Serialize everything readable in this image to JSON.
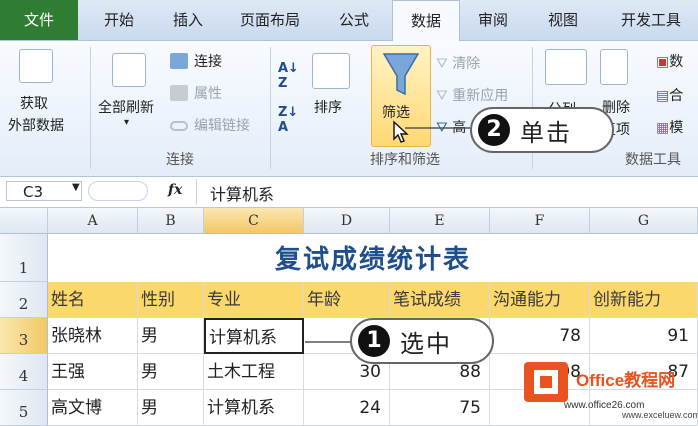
{
  "tabs": [
    "文件",
    "开始",
    "插入",
    "页面布局",
    "公式",
    "数据",
    "审阅",
    "视图",
    "开发工具"
  ],
  "ribbon": {
    "get_external_1": "获取",
    "get_external_2": "外部数据",
    "refresh_all": "全部刷新",
    "connections": "连接",
    "properties": "属性",
    "edit_links": "编辑链接",
    "group_connections": "连接",
    "sort": "排序",
    "filter": "筛选",
    "clear": "清除",
    "reapply": "重新应用",
    "advanced": "高",
    "group_sort_filter": "排序和筛选",
    "split": "分列",
    "remove": "删除",
    "remove_2": "复项",
    "data_label": "数",
    "consolidate": "合",
    "model": "模",
    "group_data_tools": "数据工具"
  },
  "formula_bar": {
    "name_box": "C3",
    "fx": "fx",
    "content": "计算机系"
  },
  "columns": [
    "A",
    "B",
    "C",
    "D",
    "E",
    "F",
    "G"
  ],
  "rows": [
    "1",
    "2",
    "3",
    "4",
    "5"
  ],
  "sheet": {
    "title": "复试成绩统计表",
    "headers": [
      "姓名",
      "性别",
      "专业",
      "年龄",
      "笔试成绩",
      "沟通能力",
      "创新能力"
    ],
    "data": [
      [
        "张晓林",
        "男",
        "计算机系",
        "",
        "",
        "78",
        "91"
      ],
      [
        "王强",
        "男",
        "土木工程",
        "30",
        "88",
        "98",
        "87"
      ],
      [
        "高文博",
        "男",
        "计算机系",
        "24",
        "75",
        "",
        ""
      ]
    ]
  },
  "callouts": [
    {
      "num": "2",
      "text": "单击"
    },
    {
      "num": "1",
      "text": "选中"
    }
  ],
  "watermark": {
    "brand": "Office教程网",
    "url": "www.office26.com",
    "url2": "www.exceluew.com"
  },
  "colors": {
    "file_tab": "#2e7d32",
    "header_fill": "#fbd86a",
    "title_text": "#1f4e8c"
  }
}
